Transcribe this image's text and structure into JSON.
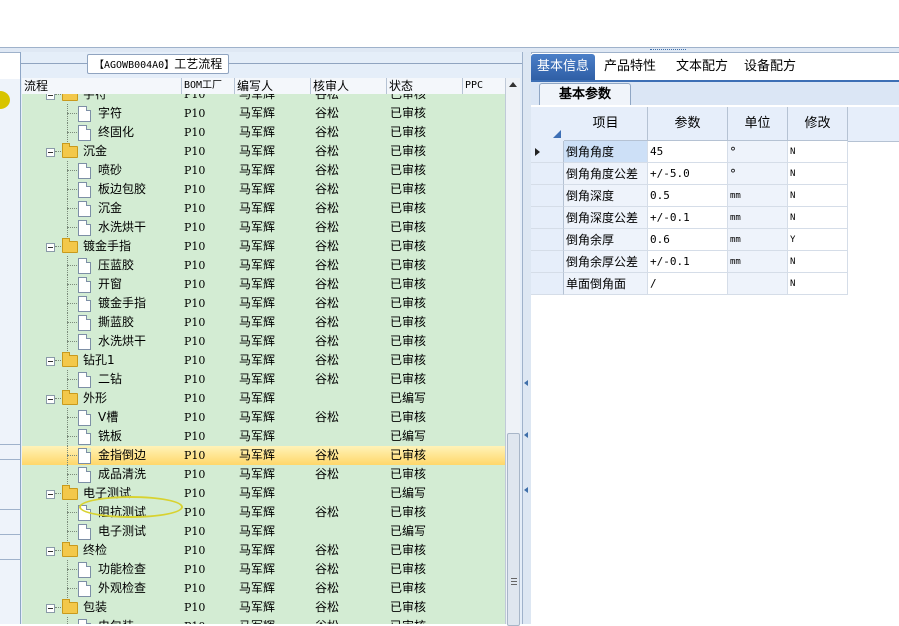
{
  "process_title": {
    "code": "【AGOWB004A0】",
    "label": "工艺流程"
  },
  "grid": {
    "headers": {
      "flow": "流程",
      "bom": "BOM工厂",
      "writer": "编写人",
      "reviewer": "核审人",
      "status": "状态",
      "ppc": "PPC"
    },
    "rows": [
      {
        "level": 0,
        "type": "folder",
        "name": "字符",
        "bom": "P10",
        "writer": "马军辉",
        "reviewer": "谷松",
        "status": "已审核",
        "partial": true
      },
      {
        "level": 1,
        "type": "doc",
        "name": "字符",
        "bom": "P10",
        "writer": "马军辉",
        "reviewer": "谷松",
        "status": "已审核"
      },
      {
        "level": 1,
        "type": "doc",
        "name": "终固化",
        "bom": "P10",
        "writer": "马军辉",
        "reviewer": "谷松",
        "status": "已审核"
      },
      {
        "level": 0,
        "type": "folder",
        "name": "沉金",
        "bom": "P10",
        "writer": "马军辉",
        "reviewer": "谷松",
        "status": "已审核"
      },
      {
        "level": 1,
        "type": "doc",
        "name": "喷砂",
        "bom": "P10",
        "writer": "马军辉",
        "reviewer": "谷松",
        "status": "已审核"
      },
      {
        "level": 1,
        "type": "doc",
        "name": "板边包胶",
        "bom": "P10",
        "writer": "马军辉",
        "reviewer": "谷松",
        "status": "已审核"
      },
      {
        "level": 1,
        "type": "doc",
        "name": "沉金",
        "bom": "P10",
        "writer": "马军辉",
        "reviewer": "谷松",
        "status": "已审核"
      },
      {
        "level": 1,
        "type": "doc",
        "name": "水洗烘干",
        "bom": "P10",
        "writer": "马军辉",
        "reviewer": "谷松",
        "status": "已审核"
      },
      {
        "level": 0,
        "type": "folder",
        "name": "镀金手指",
        "bom": "P10",
        "writer": "马军辉",
        "reviewer": "谷松",
        "status": "已审核"
      },
      {
        "level": 1,
        "type": "doc",
        "name": "压蓝胶",
        "bom": "P10",
        "writer": "马军辉",
        "reviewer": "谷松",
        "status": "已审核"
      },
      {
        "level": 1,
        "type": "doc",
        "name": "开窗",
        "bom": "P10",
        "writer": "马军辉",
        "reviewer": "谷松",
        "status": "已审核"
      },
      {
        "level": 1,
        "type": "doc",
        "name": "镀金手指",
        "bom": "P10",
        "writer": "马军辉",
        "reviewer": "谷松",
        "status": "已审核"
      },
      {
        "level": 1,
        "type": "doc",
        "name": "撕蓝胶",
        "bom": "P10",
        "writer": "马军辉",
        "reviewer": "谷松",
        "status": "已审核"
      },
      {
        "level": 1,
        "type": "doc",
        "name": "水洗烘干",
        "bom": "P10",
        "writer": "马军辉",
        "reviewer": "谷松",
        "status": "已审核"
      },
      {
        "level": 0,
        "type": "folder",
        "name": "钻孔1",
        "bom": "P10",
        "writer": "马军辉",
        "reviewer": "谷松",
        "status": "已审核"
      },
      {
        "level": 1,
        "type": "doc",
        "name": "二钻",
        "bom": "P10",
        "writer": "马军辉",
        "reviewer": "谷松",
        "status": "已审核"
      },
      {
        "level": 0,
        "type": "folder",
        "name": "外形",
        "bom": "P10",
        "writer": "马军辉",
        "reviewer": "",
        "status": "已编写"
      },
      {
        "level": 1,
        "type": "doc",
        "name": "V槽",
        "bom": "P10",
        "writer": "马军辉",
        "reviewer": "谷松",
        "status": "已审核"
      },
      {
        "level": 1,
        "type": "doc",
        "name": "铣板",
        "bom": "P10",
        "writer": "马军辉",
        "reviewer": "",
        "status": "已编写"
      },
      {
        "level": 1,
        "type": "doc",
        "name": "金指倒边",
        "bom": "P10",
        "writer": "马军辉",
        "reviewer": "谷松",
        "status": "已审核",
        "selected": true
      },
      {
        "level": 1,
        "type": "doc",
        "name": "成品清洗",
        "bom": "P10",
        "writer": "马军辉",
        "reviewer": "谷松",
        "status": "已审核"
      },
      {
        "level": 0,
        "type": "folder",
        "name": "电子测试",
        "bom": "P10",
        "writer": "马军辉",
        "reviewer": "",
        "status": "已编写"
      },
      {
        "level": 1,
        "type": "doc",
        "name": "阻抗测试",
        "bom": "P10",
        "writer": "马军辉",
        "reviewer": "谷松",
        "status": "已审核"
      },
      {
        "level": 1,
        "type": "doc",
        "name": "电子测试",
        "bom": "P10",
        "writer": "马军辉",
        "reviewer": "",
        "status": "已编写"
      },
      {
        "level": 0,
        "type": "folder",
        "name": "终检",
        "bom": "P10",
        "writer": "马军辉",
        "reviewer": "谷松",
        "status": "已审核"
      },
      {
        "level": 1,
        "type": "doc",
        "name": "功能检查",
        "bom": "P10",
        "writer": "马军辉",
        "reviewer": "谷松",
        "status": "已审核"
      },
      {
        "level": 1,
        "type": "doc",
        "name": "外观检查",
        "bom": "P10",
        "writer": "马军辉",
        "reviewer": "谷松",
        "status": "已审核"
      },
      {
        "level": 0,
        "type": "folder",
        "name": "包装",
        "bom": "P10",
        "writer": "马军辉",
        "reviewer": "谷松",
        "status": "已审核"
      },
      {
        "level": 1,
        "type": "doc",
        "name": "电包装",
        "bom": "P10",
        "writer": "马军辉",
        "reviewer": "谷松",
        "status": "已审核",
        "partial": true
      }
    ]
  },
  "right": {
    "tabs": [
      "基本信息",
      "产品特性",
      "文本配方",
      "设备配方"
    ],
    "active_tab": 0,
    "sub_tab": "基本参数",
    "headers": {
      "item": "项目",
      "param": "参数",
      "unit": "单位",
      "modify": "修改"
    },
    "rows": [
      {
        "item": "倒角角度",
        "param": "45",
        "unit": "°",
        "modify": "N",
        "current": true
      },
      {
        "item": "倒角角度公差",
        "param": "+/-5.0",
        "unit": "°",
        "modify": "N"
      },
      {
        "item": "倒角深度",
        "param": "0.5",
        "unit": "mm",
        "modify": "N"
      },
      {
        "item": "倒角深度公差",
        "param": "+/-0.1",
        "unit": "mm",
        "modify": "N"
      },
      {
        "item": "倒角余厚",
        "param": "0.6",
        "unit": "mm",
        "modify": "Y"
      },
      {
        "item": "倒角余厚公差",
        "param": "+/-0.1",
        "unit": "mm",
        "modify": "N"
      },
      {
        "item": "单面倒角面",
        "param": "/",
        "unit": "",
        "modify": "N"
      }
    ]
  }
}
